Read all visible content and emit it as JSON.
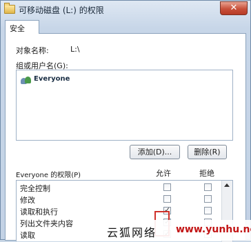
{
  "window": {
    "title": "可移动磁盘 (L:) 的权限",
    "close_glyph": "✕"
  },
  "tabs": [
    {
      "label": "安全"
    }
  ],
  "object_name": {
    "label": "对象名称:",
    "value": "L:\\"
  },
  "groups": {
    "label": "组或用户名(G):",
    "users": [
      {
        "name": "Everyone",
        "icon": "users-icon"
      }
    ]
  },
  "buttons": {
    "add": "添加(D)...",
    "remove": "删除(R)"
  },
  "permissions": {
    "title": "Everyone 的权限(P)",
    "allow_header": "允许",
    "deny_header": "拒绝",
    "rows": [
      {
        "name": "完全控制",
        "allow": false,
        "deny": false
      },
      {
        "name": "修改",
        "allow": false,
        "deny": false
      },
      {
        "name": "读取和执行",
        "allow": true,
        "deny": false
      },
      {
        "name": "列出文件夹内容",
        "allow": true,
        "deny": false
      },
      {
        "name": "读取",
        "allow": true,
        "deny": false
      }
    ]
  },
  "watermark": {
    "text": "云狐网络",
    "url": "www.yunhu.net"
  },
  "colors": {
    "highlight": "#d0302a",
    "watermark_url": "#c21414"
  }
}
